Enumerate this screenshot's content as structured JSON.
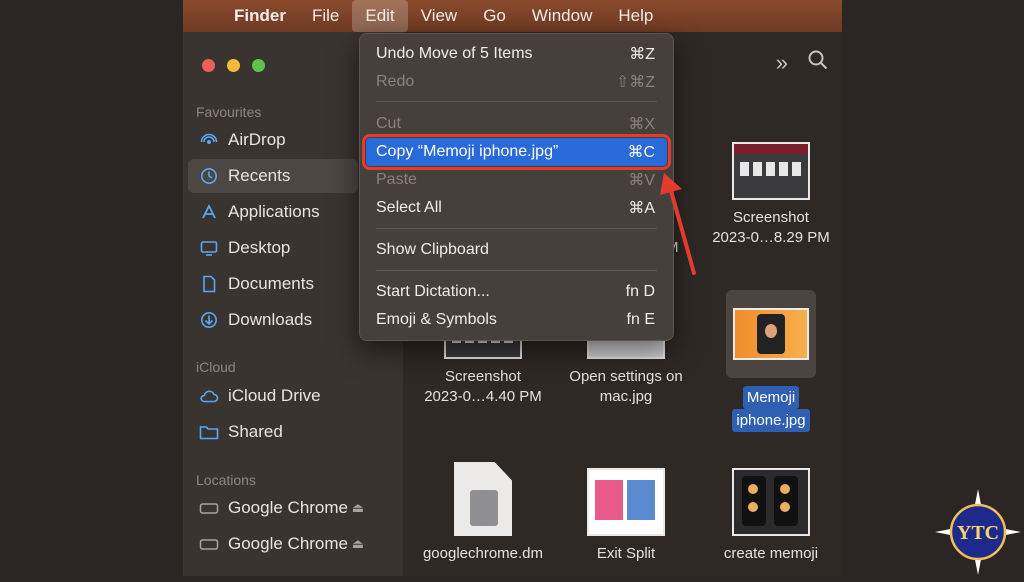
{
  "menubar": {
    "apple_icon": "apple-icon",
    "items": [
      "Finder",
      "File",
      "Edit",
      "View",
      "Go",
      "Window",
      "Help"
    ],
    "active": "Edit"
  },
  "sidebar": {
    "favourites_label": "Favourites",
    "favourites": [
      {
        "label": "AirDrop",
        "icon": "airdrop-icon"
      },
      {
        "label": "Recents",
        "icon": "clock-icon",
        "selected": true
      },
      {
        "label": "Applications",
        "icon": "applications-icon"
      },
      {
        "label": "Desktop",
        "icon": "desktop-icon"
      },
      {
        "label": "Documents",
        "icon": "document-icon"
      },
      {
        "label": "Downloads",
        "icon": "download-icon"
      }
    ],
    "icloud_label": "iCloud",
    "icloud": [
      {
        "label": "iCloud Drive",
        "icon": "cloud-icon"
      },
      {
        "label": "Shared",
        "icon": "shared-folder-icon"
      }
    ],
    "locations_label": "Locations",
    "locations": [
      {
        "label": "Google Chrome",
        "icon": "disk-icon"
      },
      {
        "label": "Google Chrome",
        "icon": "disk-icon"
      }
    ]
  },
  "files": {
    "screenshot_1": {
      "name1": "Screenshot",
      "name2": "2023-0…8.29 PM"
    },
    "partial_time": "PM",
    "memoji": {
      "name1": "Memoji",
      "name2": "iphone.jpg"
    },
    "screenshot_2": {
      "name1": "Screenshot",
      "name2": "2023-0…4.40 PM"
    },
    "open_settings": {
      "name1": "Open settings on",
      "name2": "mac.jpg"
    },
    "chrome_dmg": {
      "name1": "googlechrome.dm"
    },
    "exit_split": {
      "name1": "Exit Split"
    },
    "create_memoji": {
      "name1": "create memoji"
    }
  },
  "edit_menu": {
    "undo": {
      "label": "Undo Move of 5 Items",
      "shortcut": "⌘Z"
    },
    "redo": {
      "label": "Redo",
      "shortcut": "⇧⌘Z"
    },
    "cut": {
      "label": "Cut",
      "shortcut": "⌘X"
    },
    "copy": {
      "label": "Copy “Memoji iphone.jpg”",
      "shortcut": "⌘C"
    },
    "paste": {
      "label": "Paste",
      "shortcut": "⌘V"
    },
    "select_all": {
      "label": "Select All",
      "shortcut": "⌘A"
    },
    "show_clipboard": {
      "label": "Show Clipboard"
    },
    "start_dictation": {
      "label": "Start Dictation...",
      "shortcut": "fn D"
    },
    "emoji": {
      "label": "Emoji & Symbols",
      "shortcut": "fn E"
    }
  },
  "logo": {
    "text": "YTC"
  },
  "colors": {
    "menu_highlight": "#2a6ad8",
    "annotation_red": "#e33b2e",
    "selection_blue": "#2e5fb3"
  }
}
